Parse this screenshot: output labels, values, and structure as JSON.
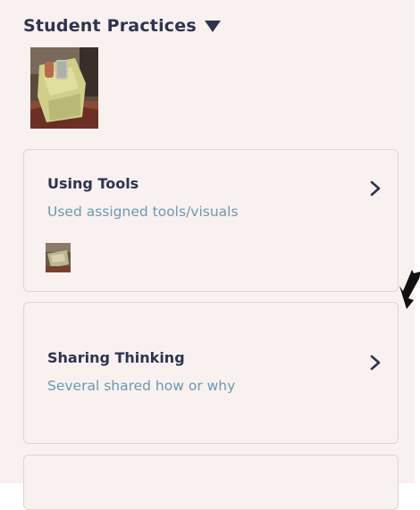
{
  "section": {
    "title": "Student Practices"
  },
  "cards": [
    {
      "title": "Using Tools",
      "subtitle": "Used assigned tools/visuals"
    },
    {
      "title": "Sharing Thinking",
      "subtitle": "Several shared how or why"
    }
  ],
  "colors": {
    "background": "#f8f1ef",
    "title": "#2e3350",
    "subtitle": "#6e97b3",
    "border": "#dcd6d3"
  },
  "icons": {
    "section_toggle": "caret-down-icon",
    "card_action": "chevron-right-icon"
  }
}
